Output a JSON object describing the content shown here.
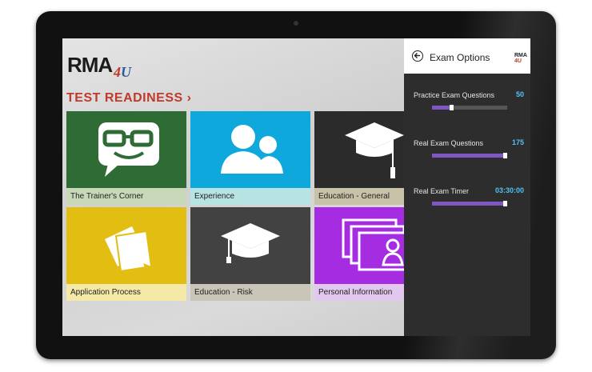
{
  "app": {
    "logo_main": "RMA",
    "logo_sub_a": "4",
    "logo_sub_b": "U",
    "section_title": "TEST READINESS ›"
  },
  "tiles": [
    {
      "label": "The Trainer's Corner",
      "color": "#2e6b35",
      "caption_bg": "#c9d8b9",
      "icon": "glasses-face-speech-bubble-icon"
    },
    {
      "label": "Experience",
      "color": "#0fa8dd",
      "caption_bg": "#b7e3e3",
      "icon": "people-icon"
    },
    {
      "label": "Education - General",
      "color": "#2b2b2b",
      "caption_bg": "#c8c2a8",
      "icon": "graduation-cap-icon"
    },
    {
      "label": "Application Process",
      "color": "#e3be12",
      "caption_bg": "#f4e9a6",
      "icon": "documents-icon"
    },
    {
      "label": "Education - Risk",
      "color": "#424242",
      "caption_bg": "#c9c6b9",
      "icon": "graduation-cap-icon"
    },
    {
      "label": "Personal Information",
      "color": "#a52ce0",
      "caption_bg": "#e2c8ee",
      "icon": "profile-cards-icon"
    }
  ],
  "panel": {
    "title": "Exam Options",
    "mini_logo_main": "RMA",
    "mini_logo_sub": "4U",
    "options": [
      {
        "label": "Practice Exam Questions",
        "value": "50",
        "fraction": 0.25
      },
      {
        "label": "Real Exam Questions",
        "value": "175",
        "fraction": 0.97
      },
      {
        "label": "Real Exam Timer",
        "value": "03:30:00",
        "fraction": 0.97
      }
    ]
  },
  "colors": {
    "accent": "#c0392b",
    "value_blue": "#4fc3f7",
    "slider": "#7e57c2"
  }
}
